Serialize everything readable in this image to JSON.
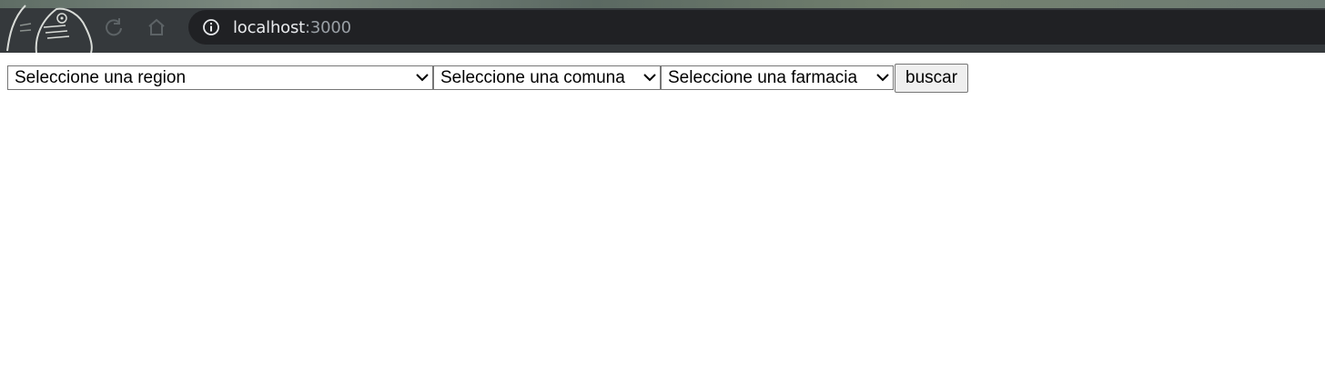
{
  "browser": {
    "url_host": "localhost",
    "url_port": ":3000"
  },
  "form": {
    "region_select": "Seleccione una region",
    "comuna_select": "Seleccione una comuna",
    "farmacia_select": "Seleccione una farmacia",
    "search_button": "buscar"
  }
}
